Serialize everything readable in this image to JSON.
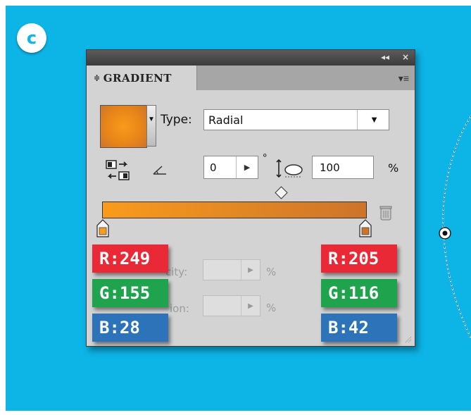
{
  "badge": {
    "letter": "c"
  },
  "panel": {
    "collapse_glyph": "◂◂",
    "close_glyph": "×",
    "tab_updown_glyph": "≑",
    "tab_label": "GRADIENT",
    "menu_glyph": "▾≡",
    "type_label": "Type:",
    "type_value": "Radial",
    "angle_value": "0",
    "degree_symbol": "°",
    "aspect_value": "100",
    "percent_symbol": "%",
    "opacity_label_partial": "city:",
    "location_label_partial": "ion:",
    "opacity_unit": "%",
    "location_unit": "%"
  },
  "icons": {
    "reverse": "reverse-gradient-icon",
    "angle": "angle-icon",
    "aspect": "aspect-ratio-icon",
    "trash": "trash-icon",
    "midpoint": "midpoint-diamond-icon",
    "radial_center": "radial-center-icon"
  },
  "colors": {
    "background": "#0db4e6",
    "gradient_start": "#f99b1c",
    "gradient_end": "#cd742a",
    "chip_red": "#ea2937",
    "chip_green": "#1fa34d",
    "chip_blue": "#2c73b9"
  },
  "left_stop": {
    "r": "R:249",
    "g": "G:155",
    "b": "B:28"
  },
  "right_stop": {
    "r": "R:205",
    "g": "G:116",
    "b": "B:42"
  }
}
